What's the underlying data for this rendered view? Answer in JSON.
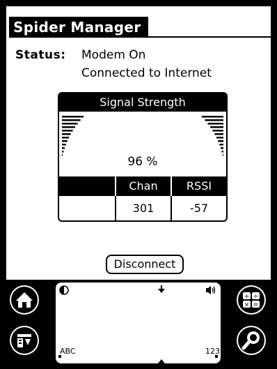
{
  "app": {
    "title": "Spider Manager"
  },
  "status": {
    "label": "Status:",
    "line1": "Modem On",
    "line2": "Connected to Internet"
  },
  "signal": {
    "header": "Signal Strength",
    "percent_text": "96 %",
    "strength_percent": 96
  },
  "table": {
    "headers": [
      "",
      "Chan",
      "RSSI"
    ],
    "values": [
      "",
      "301",
      "-57"
    ]
  },
  "actions": {
    "disconnect_label": "Disconnect"
  },
  "silkscreen": {
    "abc_label": "ABC",
    "num_label": "123",
    "icons": [
      "home-icon",
      "menu-icon",
      "calculator-icon",
      "find-icon",
      "brightness-icon",
      "sound-icon"
    ]
  }
}
